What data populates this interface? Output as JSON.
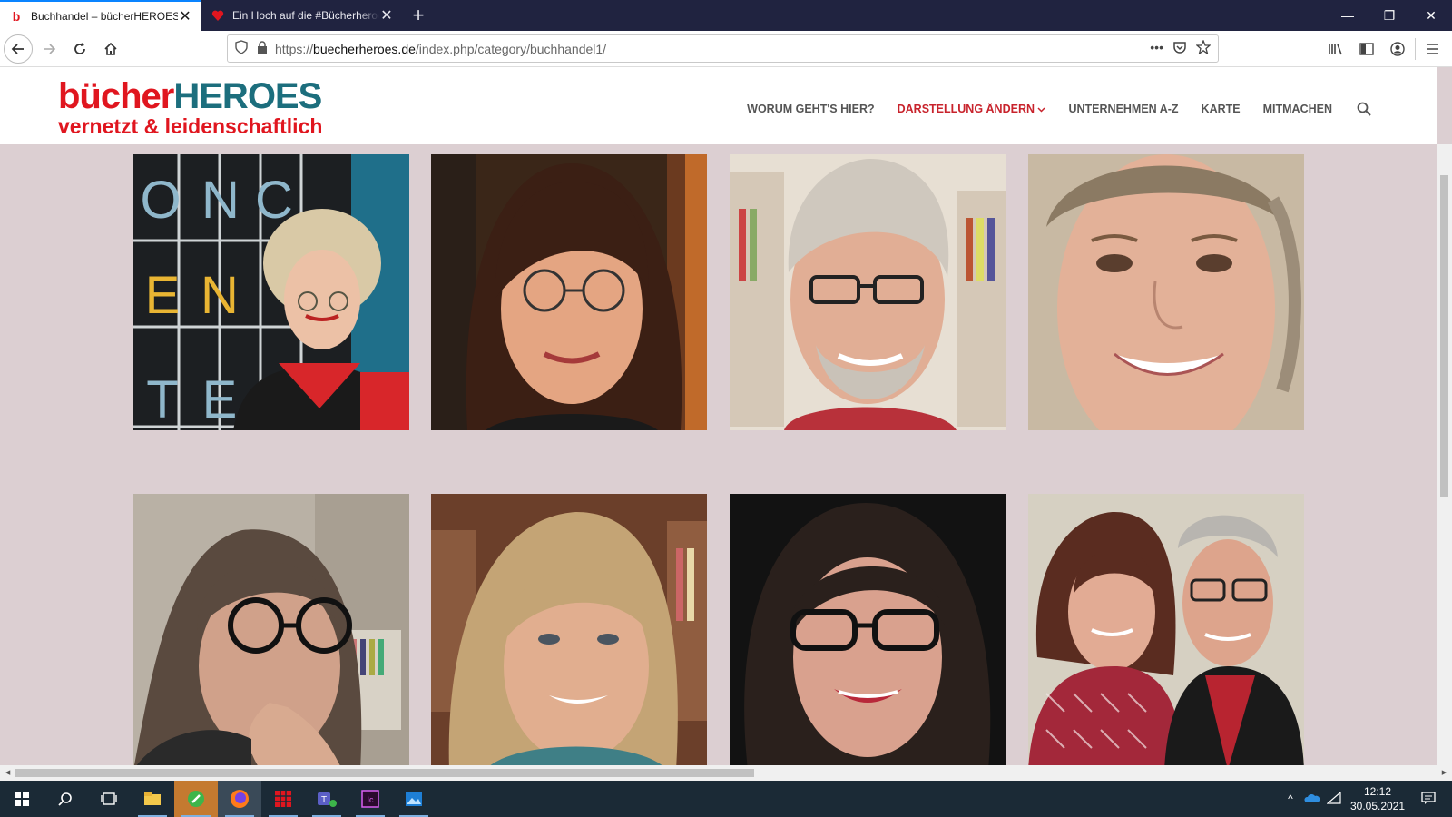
{
  "browser": {
    "tabs": [
      {
        "title": "Buchhandel – bücherHEROES",
        "favicon": "b",
        "active": true
      },
      {
        "title": "Ein Hoch auf die #Bücherheroe",
        "favicon": "heart-icon",
        "active": false
      }
    ],
    "new_tab": "+",
    "url_proto": "https://",
    "url_host": "buecherheroes.de",
    "url_path": "/index.php/category/buchhandel1/"
  },
  "site": {
    "logo_part1": "bücher",
    "logo_part2": "HEROES",
    "tagline": "vernetzt & leidenschaftlich",
    "nav": [
      {
        "label": "WORUM GEHT'S HIER?",
        "current": false
      },
      {
        "label": "DARSTELLUNG ÄNDERN",
        "current": true,
        "dropdown": true
      },
      {
        "label": "UNTERNEHMEN A-Z",
        "current": false
      },
      {
        "label": "KARTE",
        "current": false
      },
      {
        "label": "MITMACHEN",
        "current": false
      }
    ],
    "colors": {
      "brand_red": "#e0161f",
      "brand_teal": "#1c6e7d",
      "page_bg": "#dccfd2"
    }
  },
  "photos": [
    {
      "desc": "bookseller-portrait-1"
    },
    {
      "desc": "bookseller-portrait-2"
    },
    {
      "desc": "bookseller-portrait-3"
    },
    {
      "desc": "bookseller-portrait-4"
    },
    {
      "desc": "bookseller-portrait-5"
    },
    {
      "desc": "bookseller-portrait-6"
    },
    {
      "desc": "bookseller-portrait-7"
    },
    {
      "desc": "bookseller-portrait-8"
    }
  ],
  "photo1_letters": [
    "O",
    "N",
    "C",
    "E",
    "N",
    "T",
    "E"
  ],
  "taskbar": {
    "time": "12:12",
    "date": "30.05.2021"
  }
}
